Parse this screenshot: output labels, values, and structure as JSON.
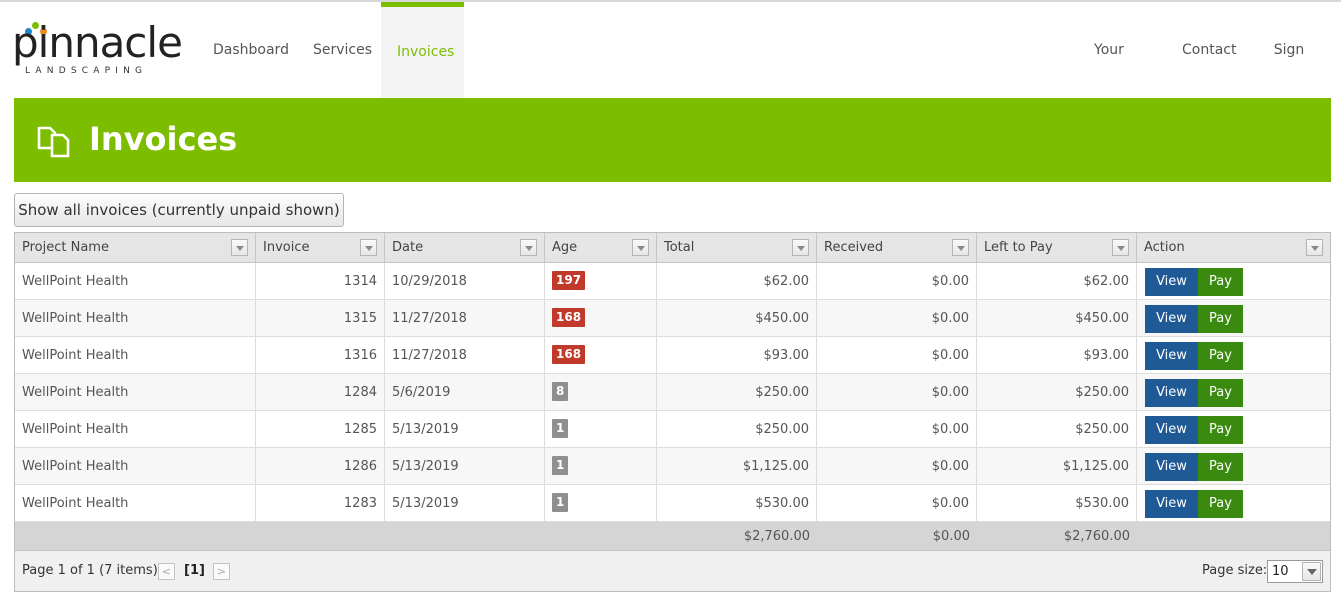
{
  "brand": {
    "name": "pinnacle",
    "tagline": "LANDSCAPING"
  },
  "nav": {
    "left": [
      {
        "label": "Dashboard",
        "active": false
      },
      {
        "label": "Services",
        "active": false
      },
      {
        "label": "Invoices",
        "active": true
      }
    ],
    "right": [
      {
        "label": "Your Account"
      },
      {
        "label": "Contact"
      },
      {
        "label": "Sign out"
      }
    ]
  },
  "page": {
    "title": "Invoices",
    "icon": "documents-icon"
  },
  "toolbar": {
    "show_all_label": "Show all invoices (currently unpaid shown)"
  },
  "grid": {
    "columns": [
      "Project Name",
      "Invoice",
      "Date",
      "Age",
      "Total",
      "Received",
      "Left to Pay",
      "Action"
    ],
    "rows": [
      {
        "project": "WellPoint Health",
        "invoice": "1314",
        "date": "10/29/2018",
        "age": "197",
        "age_status": "overdue",
        "total": "$62.00",
        "received": "$0.00",
        "left": "$62.00"
      },
      {
        "project": "WellPoint Health",
        "invoice": "1315",
        "date": "11/27/2018",
        "age": "168",
        "age_status": "overdue",
        "total": "$450.00",
        "received": "$0.00",
        "left": "$450.00"
      },
      {
        "project": "WellPoint Health",
        "invoice": "1316",
        "date": "11/27/2018",
        "age": "168",
        "age_status": "overdue",
        "total": "$93.00",
        "received": "$0.00",
        "left": "$93.00"
      },
      {
        "project": "WellPoint Health",
        "invoice": "1284",
        "date": "5/6/2019",
        "age": "8",
        "age_status": "recent",
        "total": "$250.00",
        "received": "$0.00",
        "left": "$250.00"
      },
      {
        "project": "WellPoint Health",
        "invoice": "1285",
        "date": "5/13/2019",
        "age": "1",
        "age_status": "recent",
        "total": "$250.00",
        "received": "$0.00",
        "left": "$250.00"
      },
      {
        "project": "WellPoint Health",
        "invoice": "1286",
        "date": "5/13/2019",
        "age": "1",
        "age_status": "recent",
        "total": "$1,125.00",
        "received": "$0.00",
        "left": "$1,125.00"
      },
      {
        "project": "WellPoint Health",
        "invoice": "1283",
        "date": "5/13/2019",
        "age": "1",
        "age_status": "recent",
        "total": "$530.00",
        "received": "$0.00",
        "left": "$530.00"
      }
    ],
    "actions": {
      "view": "View",
      "pay": "Pay"
    },
    "totals": {
      "total": "$2,760.00",
      "received": "$0.00",
      "left": "$2,760.00"
    }
  },
  "pager": {
    "info": "Page 1 of 1 (7 items)",
    "current": "[1]",
    "prev": "<",
    "next": ">",
    "page_size_label": "Page size:",
    "page_size": "10"
  },
  "colors": {
    "accent": "#7dbd00",
    "overdue": "#c0392b",
    "recent": "#8f8f8f",
    "view_button": "#1f5a96",
    "pay_button": "#3a8a10"
  }
}
